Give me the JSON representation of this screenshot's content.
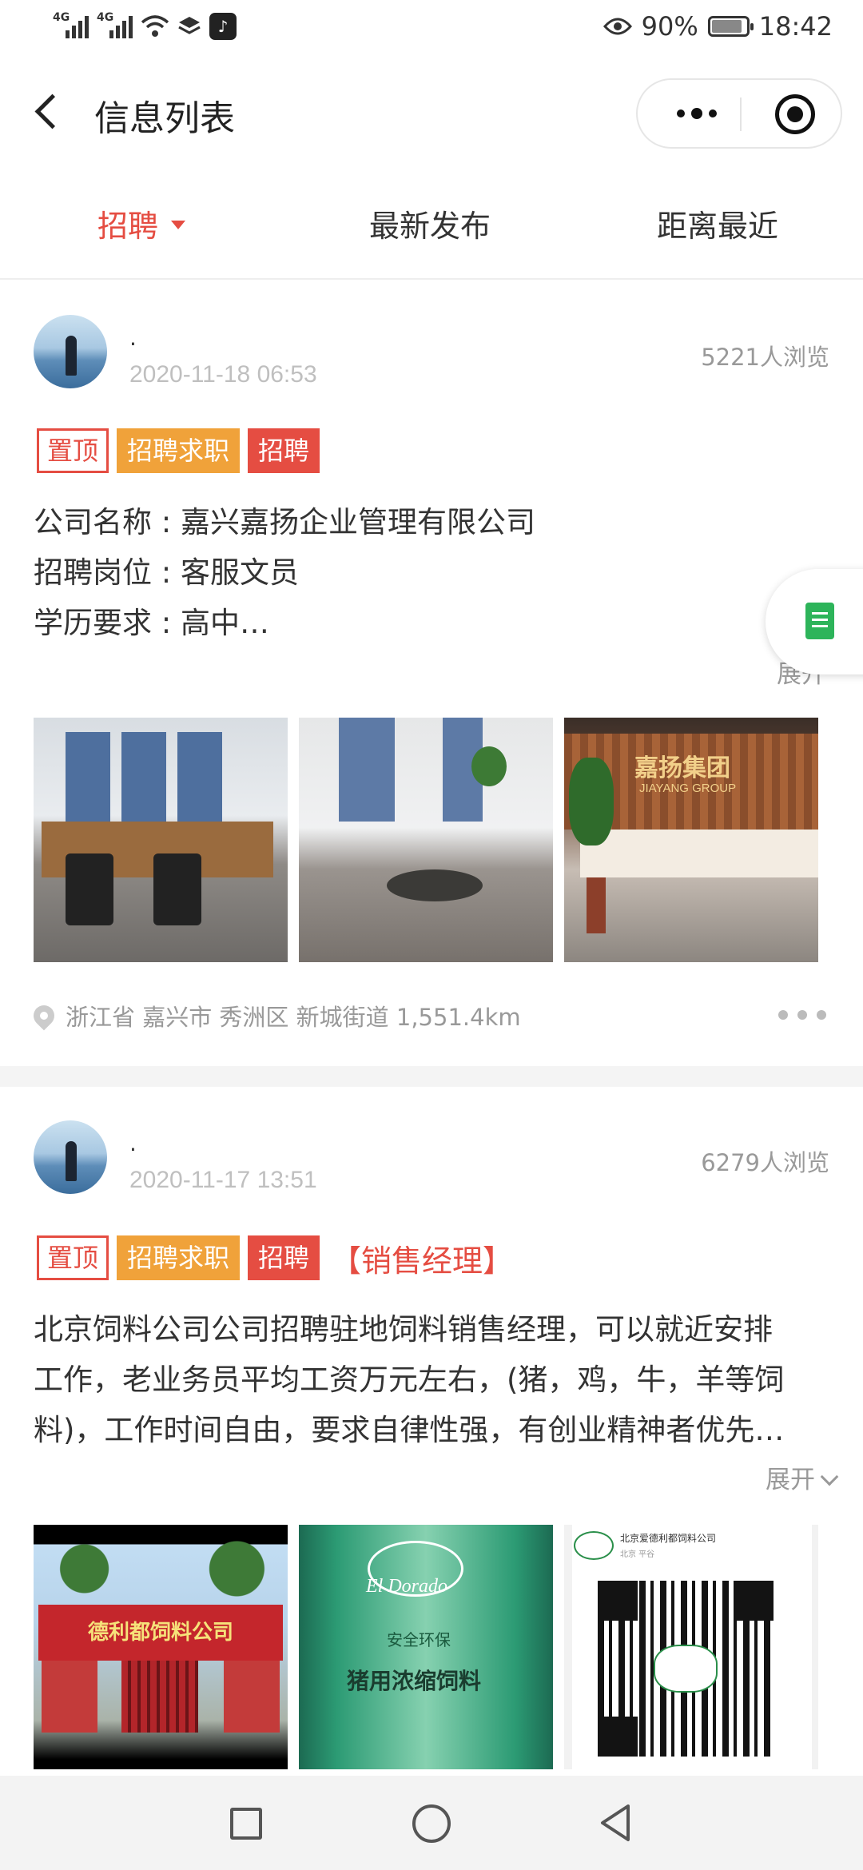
{
  "status_bar": {
    "net1": "4G",
    "net2": "4G",
    "tiktok_icon": "tiktok-icon",
    "battery_pct": "90%",
    "time": "18:42"
  },
  "nav": {
    "title": "信息列表"
  },
  "tabs": [
    {
      "label": "招聘",
      "active": true
    },
    {
      "label": "最新发布",
      "active": false
    },
    {
      "label": "距离最近",
      "active": false
    }
  ],
  "posts": [
    {
      "username": "·",
      "date": "2020-11-18 06:53",
      "views": "5221人浏览",
      "tags": [
        "置顶",
        "招聘求职",
        "招聘"
      ],
      "lines": [
        "公司名称 : 嘉兴嘉扬企业管理有限公司",
        "招聘岗位 : 客服文员",
        "学历要求 : 高中…"
      ],
      "expand": "展开",
      "photo3_brand": "嘉扬集团",
      "photo3_brand_en": "JIAYANG GROUP",
      "location": "浙江省 嘉兴市 秀洲区 新城街道 1,551.4km"
    },
    {
      "username": "·",
      "date": "2020-11-17 13:51",
      "views": "6279人浏览",
      "tags": [
        "置顶",
        "招聘求职",
        "招聘"
      ],
      "title_tag": "【销售经理】",
      "lines": [
        "北京饲料公司公司招聘驻地饲料销售经理，可以就近安排",
        "工作，老业务员平均工资万元左右，(猪，鸡，牛，羊等饲",
        "料)，工作时间自由，要求自律性强，有创业精神者优先…"
      ],
      "expand": "展开",
      "photo1_banner": "德利都饲料公司",
      "photo2_brand": "El Dorado",
      "photo2_line1": "安全环保",
      "photo2_line2": "猪用浓缩饲料",
      "photo3_name": "北京爱德利都饲料公司",
      "photo3_sub": "北京 平谷"
    }
  ]
}
